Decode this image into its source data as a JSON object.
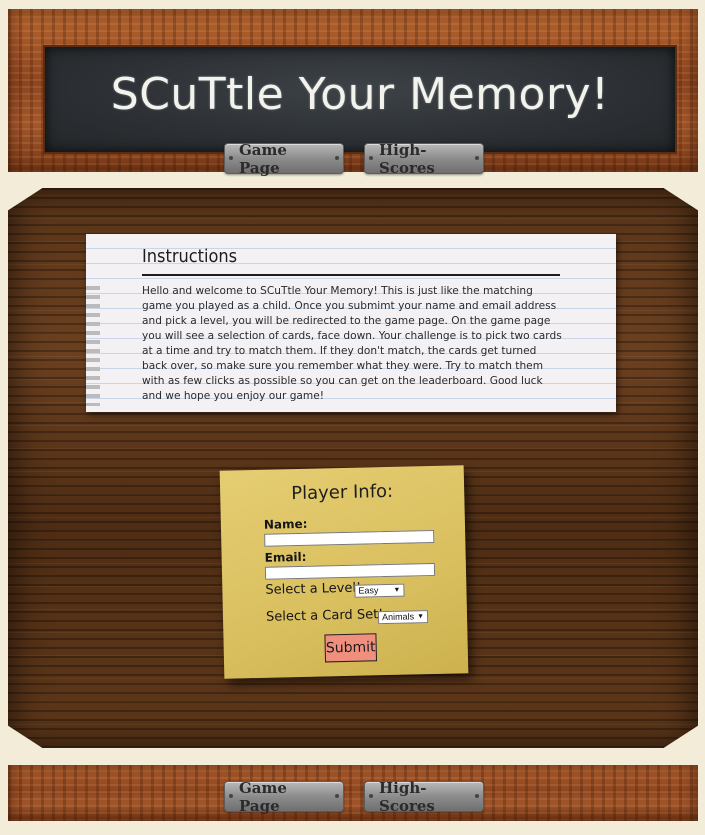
{
  "header": {
    "title": "SCuTtle Your Memory!"
  },
  "nav": {
    "game_page": "Game Page",
    "high_scores": "High-Scores"
  },
  "instructions": {
    "heading": "Instructions",
    "body": "Hello and welcome to SCuTtle Your Memory! This is just like the matching game you played as a child. Once you submimt your name and email address and pick a level, you will be redirected to the game page. On the game page you will see a selection of cards, face down. Your challenge is to pick two cards at a time and try to match them. If they don't match, the cards get turned back over, so make sure you remember what they were. Try to match them with as few clicks as possible so you can get on the leaderboard. Good luck and we hope you enjoy our game!"
  },
  "player_form": {
    "heading": "Player Info:",
    "name_label": "Name:",
    "name_value": "",
    "email_label": "Email:",
    "email_value": "",
    "level_label": "Select a Level!",
    "level_value": "Easy",
    "cardset_label": "Select a Card Set!",
    "cardset_value": "Animals",
    "submit_label": "Submit"
  },
  "footer_nav": {
    "game_page": "Game Page",
    "high_scores": "High-Scores"
  }
}
